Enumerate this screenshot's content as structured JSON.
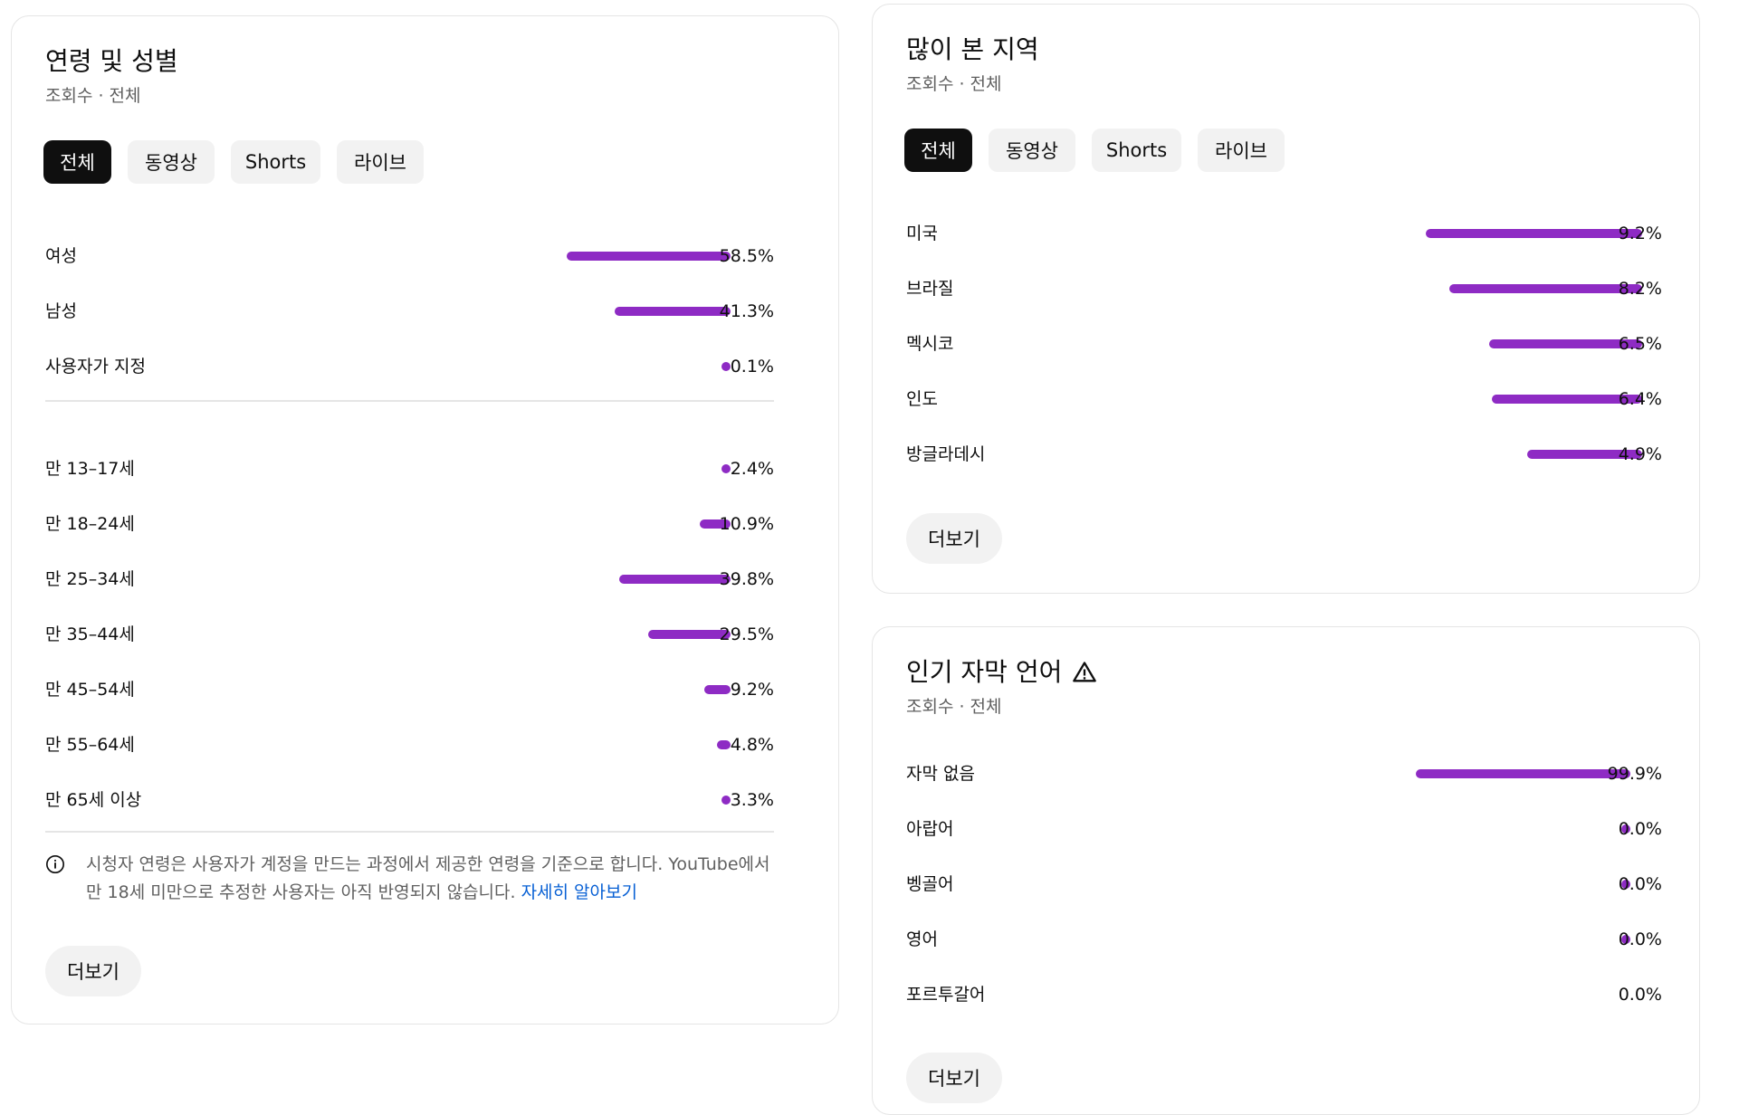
{
  "colors": {
    "bar": "#8e2bc4",
    "chip_active_bg": "#0f0f0f",
    "chip_bg": "#f2f2f2",
    "link": "#065fd4"
  },
  "age_gender": {
    "title": "연령 및 성별",
    "subtitle": "조회수 · 전체",
    "chips": [
      "전체",
      "동영상",
      "Shorts",
      "라이브"
    ],
    "gender_rows": [
      {
        "label": "여성",
        "value": "58.5%",
        "pct": 58.5
      },
      {
        "label": "남성",
        "value": "41.3%",
        "pct": 41.3
      },
      {
        "label": "사용자가 지정",
        "value": "0.1%",
        "pct": 0.1
      }
    ],
    "age_rows": [
      {
        "label": "만 13–17세",
        "value": "2.4%",
        "pct": 2.4
      },
      {
        "label": "만 18–24세",
        "value": "10.9%",
        "pct": 10.9
      },
      {
        "label": "만 25–34세",
        "value": "39.8%",
        "pct": 39.8
      },
      {
        "label": "만 35–44세",
        "value": "29.5%",
        "pct": 29.5
      },
      {
        "label": "만 45–54세",
        "value": "9.2%",
        "pct": 9.2
      },
      {
        "label": "만 55–64세",
        "value": "4.8%",
        "pct": 4.8
      },
      {
        "label": "만 65세 이상",
        "value": "3.3%",
        "pct": 3.3
      }
    ],
    "note_text": "시청자 연령은 사용자가 계정을 만드는 과정에서 제공한 연령을 기준으로 합니다. YouTube에서 만 18세 미만으로 추정한 사용자는 아직 반영되지 않습니다. ",
    "note_link": "자세히 알아보기",
    "more": "더보기"
  },
  "regions": {
    "title": "많이 본 지역",
    "subtitle": "조회수 · 전체",
    "chips": [
      "전체",
      "동영상",
      "Shorts",
      "라이브"
    ],
    "rows": [
      {
        "label": "미국",
        "value": "9.2%",
        "pct": 9.2
      },
      {
        "label": "브라질",
        "value": "8.2%",
        "pct": 8.2
      },
      {
        "label": "멕시코",
        "value": "6.5%",
        "pct": 6.5
      },
      {
        "label": "인도",
        "value": "6.4%",
        "pct": 6.4
      },
      {
        "label": "방글라데시",
        "value": "4.9%",
        "pct": 4.9
      }
    ],
    "more": "더보기"
  },
  "subtitles": {
    "title": "인기 자막 언어",
    "subtitle": "조회수 · 전체",
    "rows": [
      {
        "label": "자막 없음",
        "value": "99.9%",
        "pct": 99.9
      },
      {
        "label": "아랍어",
        "value": "0.0%",
        "pct": 0.04
      },
      {
        "label": "벵골어",
        "value": "0.0%",
        "pct": 0.04
      },
      {
        "label": "영어",
        "value": "0.0%",
        "pct": 0.04
      },
      {
        "label": "포르투갈어",
        "value": "0.0%",
        "pct": 0
      }
    ],
    "more": "더보기"
  }
}
